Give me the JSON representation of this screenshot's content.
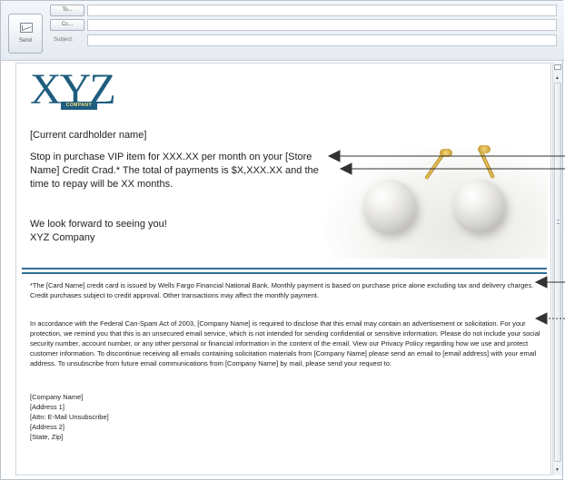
{
  "compose": {
    "send_label": "Send",
    "to_label": "To...",
    "cc_label": "Cc...",
    "subject_label": "Subject:",
    "to_value": "",
    "cc_value": "",
    "subject_value": ""
  },
  "logo": {
    "letters": "XYZ",
    "subtext": "COMPANY"
  },
  "email": {
    "salutation": "[Current cardholder name]",
    "offer": "Stop in purchase VIP item for XXX.XX per month on your [Store Name] Credit Crad.* The total of payments is $X,XXX.XX and the time to repay will be XX months.",
    "closing_line1": "We look forward to seeing you!",
    "closing_line2": "XYZ Company",
    "disclaimer": "*The [Card Name] credit card is issued by Wells Fargo Financial National Bank. Monthly payment is based on purchase price alone excluding tax and delivery charges. Credit purchases subject to credit approval. Other transactions may affect the monthly payment.",
    "legal": "In accordance with the Federal Can-Spam Act of 2003, [Company Name] is required to disclose that this email may contain an advertisement or solicitation. For your protection, we remind you that this is an unsecured email service, which is not intended for sending confidential or sensitive information. Please do not include your social security number, account number, or any other personal or financial information in the content of the email. View our Privacy Policy regarding how we use and protect customer information. To discontinue receiving all emails containing solicitation materials from [Company Name] please send an email to [email address] with your email address. To unsubscribe from future email communications from [Company Name] by mail, please send your request to:",
    "address": [
      "[Company Name]",
      "[Address 1]",
      "[Attn: E-Mail Unsubscribe]",
      "[Address 2]",
      "[State, Zip]"
    ]
  },
  "image": {
    "icon": "pearl-earrings-image"
  },
  "colors": {
    "brand": "#1e5d7e",
    "logo_accent": "#fbe27a",
    "rule": "#2f6f97"
  }
}
